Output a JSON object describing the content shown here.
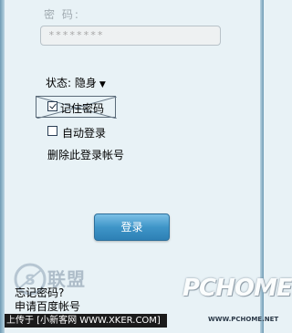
{
  "login": {
    "password_label": "密 码:",
    "password_value": "********",
    "status_label": "状态: 隐身",
    "status_chevron": "▼",
    "remember_label": "记住密码",
    "remember_checked": true,
    "auto_login_label": "自动登录",
    "auto_login_checked": false,
    "delete_account_link": "删除此登录帐号",
    "login_button": "登录",
    "forgot_password": "忘记密码?",
    "apply_account": "申请百度帐号"
  },
  "watermarks": {
    "xker_logo": "S",
    "lianmeng": "联盟",
    "pchome_logo": "PCHOME",
    "pchome_url": "WWW.PCHOME.NET",
    "upload_bar": "上传于 [小新客网 WWW.XKER.COM]"
  },
  "colors": {
    "background": "#e8f2f6",
    "button_top": "#7cc0e6",
    "button_bottom": "#2d80b5"
  }
}
